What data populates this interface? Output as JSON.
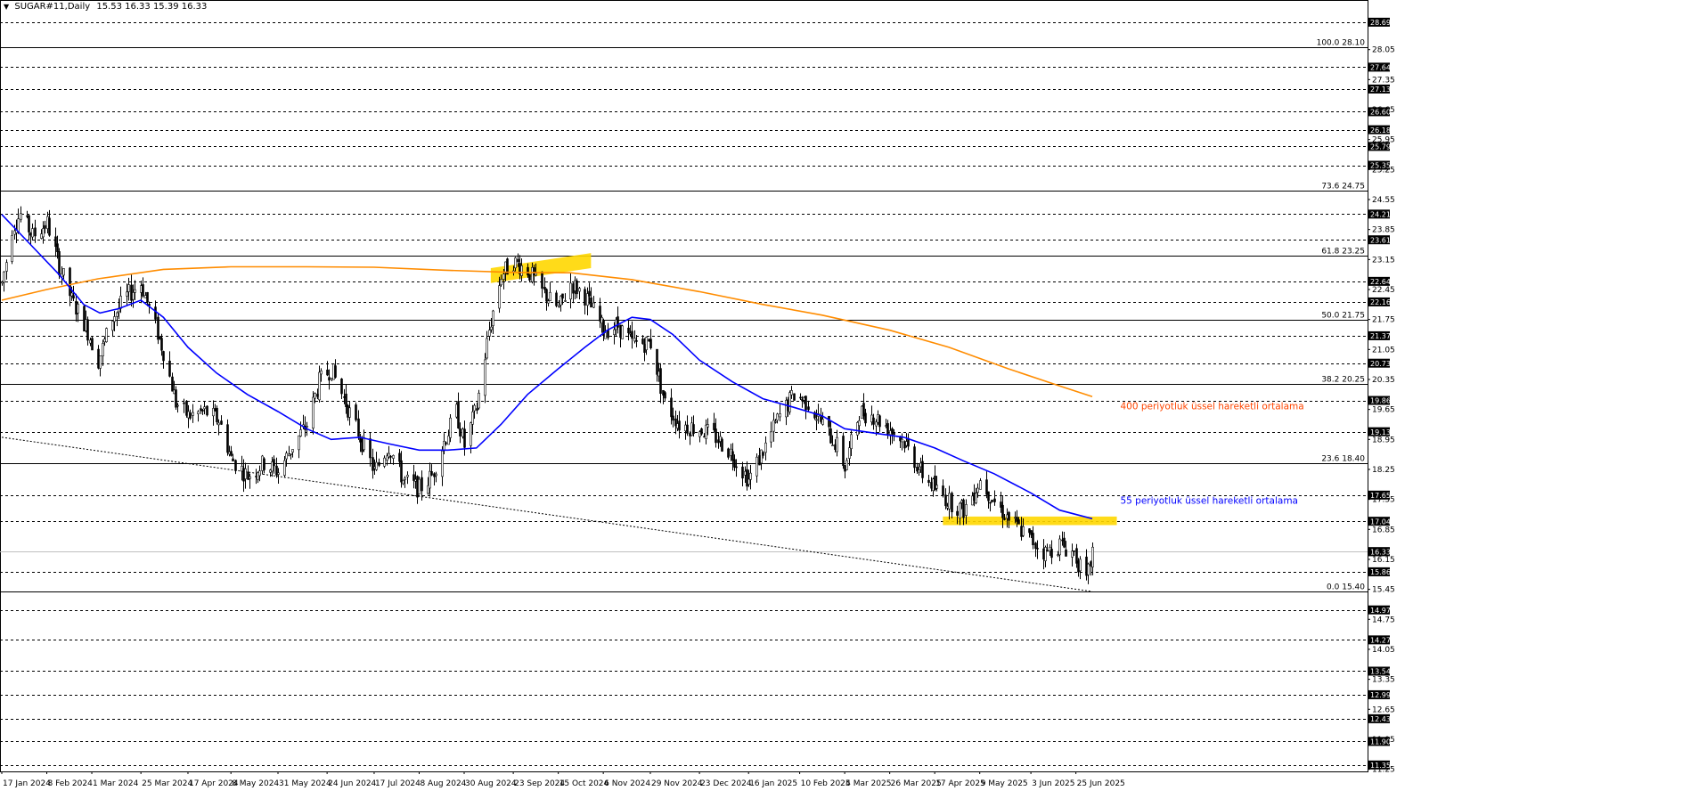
{
  "main": {
    "symbol_bar": {
      "symbol": "SUGAR#11,Daily",
      "ohlc": "15.53 16.33 15.39 16.33"
    },
    "colors": {
      "background": "#ffffff",
      "grid_dashed": "#000000",
      "candle": "#000000",
      "ema55": "#0000ff",
      "ema400": "#ff8c00",
      "highlight": "#ffd700",
      "label_blue": "#0000ff",
      "label_orange": "#ff4500",
      "axis_badge_bg": "#000000",
      "axis_badge_text": "#ffffff",
      "current_price_line": "#c0c0c0"
    },
    "annotations": [
      {
        "text": "400 periyotluk üssel hareketli ortalama",
        "color": "#ff4500",
        "anchor_date": "2025-07-08",
        "price": 19.65
      },
      {
        "text": "55 periyotluk üssel hareketli ortalama",
        "color": "#0000ff",
        "anchor_date": "2025-07-08",
        "price": 17.45
      }
    ]
  },
  "chart_data": {
    "type": "candlestick",
    "title": "SUGAR#11,Daily",
    "ylim": [
      11.2,
      29.0
    ],
    "x_start": "2024-01-17",
    "x_end": "2025-07-03",
    "current_price": 16.33,
    "axis_badges": [
      28.69,
      27.64,
      27.13,
      26.6,
      26.18,
      25.79,
      25.35,
      24.21,
      23.61,
      22.64,
      22.16,
      21.37,
      20.73,
      19.86,
      19.13,
      17.65,
      17.04,
      16.33,
      15.86,
      14.97,
      14.27,
      13.54,
      12.99,
      12.43,
      11.9,
      11.35
    ],
    "axis_small_ticks": [
      28.05,
      27.35,
      26.65,
      25.95,
      25.25,
      24.55,
      23.85,
      23.15,
      22.45,
      21.75,
      21.05,
      20.35,
      19.65,
      18.95,
      18.25,
      17.55,
      16.85,
      16.15,
      15.45,
      14.75,
      14.05,
      13.35,
      12.65,
      11.95,
      11.25
    ],
    "dashed_levels": [
      28.69,
      27.64,
      27.13,
      26.6,
      26.18,
      25.79,
      25.35,
      24.21,
      23.61,
      22.64,
      22.16,
      21.37,
      20.73,
      19.86,
      19.13,
      17.65,
      17.04,
      15.86,
      14.97,
      14.27,
      13.54,
      12.99,
      12.43,
      11.9,
      11.35
    ],
    "fib_levels": [
      {
        "label": "100.0 28.10",
        "value": 28.1
      },
      {
        "label": "73.6 24.75",
        "value": 24.75
      },
      {
        "label": "61.8 23.25",
        "value": 23.25
      },
      {
        "label": "50.0 21.75",
        "value": 21.75
      },
      {
        "label": "38.2 20.25",
        "value": 20.25
      },
      {
        "label": "23.6 18.40",
        "value": 18.4
      },
      {
        "label": "0.0 15.40",
        "value": 15.4
      }
    ],
    "date_labels": [
      {
        "label": "17 Jan 2024",
        "date": "2024-01-17"
      },
      {
        "label": "8 Feb 2024",
        "date": "2024-02-08"
      },
      {
        "label": "1 Mar 2024",
        "date": "2024-03-01"
      },
      {
        "label": "25 Mar 2024",
        "date": "2024-03-25"
      },
      {
        "label": "17 Apr 2024",
        "date": "2024-04-17"
      },
      {
        "label": "8 May 2024",
        "date": "2024-05-08"
      },
      {
        "label": "31 May 2024",
        "date": "2024-05-31"
      },
      {
        "label": "24 Jun 2024",
        "date": "2024-06-24"
      },
      {
        "label": "17 Jul 2024",
        "date": "2024-07-17"
      },
      {
        "label": "8 Aug 2024",
        "date": "2024-08-08"
      },
      {
        "label": "30 Aug 2024",
        "date": "2024-08-30"
      },
      {
        "label": "23 Sep 2024",
        "date": "2024-09-23"
      },
      {
        "label": "15 Oct 2024",
        "date": "2024-10-15"
      },
      {
        "label": "6 Nov 2024",
        "date": "2024-11-06"
      },
      {
        "label": "29 Nov 2024",
        "date": "2024-11-29"
      },
      {
        "label": "23 Dec 2024",
        "date": "2024-12-23"
      },
      {
        "label": "16 Jan 2025",
        "date": "2025-01-16"
      },
      {
        "label": "10 Feb 2025",
        "date": "2025-02-10"
      },
      {
        "label": "4 Mar 2025",
        "date": "2025-03-04"
      },
      {
        "label": "26 Mar 2025",
        "date": "2025-03-26"
      },
      {
        "label": "17 Apr 2025",
        "date": "2025-04-17"
      },
      {
        "label": "9 May 2025",
        "date": "2025-05-09"
      },
      {
        "label": "3 Jun 2025",
        "date": "2025-06-03"
      },
      {
        "label": "25 Jun 2025",
        "date": "2025-06-25"
      }
    ],
    "price_path": [
      [
        "2024-01-17",
        22.6
      ],
      [
        "2024-01-22",
        23.9
      ],
      [
        "2024-01-26",
        24.2
      ],
      [
        "2024-02-01",
        23.7
      ],
      [
        "2024-02-08",
        24.0
      ],
      [
        "2024-02-14",
        23.0
      ],
      [
        "2024-02-20",
        22.2
      ],
      [
        "2024-02-27",
        21.6
      ],
      [
        "2024-03-04",
        20.8
      ],
      [
        "2024-03-11",
        21.8
      ],
      [
        "2024-03-18",
        22.3
      ],
      [
        "2024-03-25",
        22.6
      ],
      [
        "2024-03-29",
        22.0
      ],
      [
        "2024-04-05",
        21.0
      ],
      [
        "2024-04-11",
        19.8
      ],
      [
        "2024-04-17",
        19.5
      ],
      [
        "2024-04-25",
        19.6
      ],
      [
        "2024-05-02",
        19.4
      ],
      [
        "2024-05-08",
        18.5
      ],
      [
        "2024-05-16",
        18.1
      ],
      [
        "2024-05-24",
        18.4
      ],
      [
        "2024-05-31",
        18.2
      ],
      [
        "2024-06-07",
        18.8
      ],
      [
        "2024-06-14",
        19.3
      ],
      [
        "2024-06-20",
        20.3
      ],
      [
        "2024-06-26",
        20.6
      ],
      [
        "2024-07-03",
        19.8
      ],
      [
        "2024-07-10",
        19.0
      ],
      [
        "2024-07-17",
        18.2
      ],
      [
        "2024-07-24",
        18.8
      ],
      [
        "2024-07-31",
        18.0
      ],
      [
        "2024-08-08",
        17.8
      ],
      [
        "2024-08-14",
        18.1
      ],
      [
        "2024-08-20",
        18.9
      ],
      [
        "2024-08-26",
        19.6
      ],
      [
        "2024-08-30",
        18.8
      ],
      [
        "2024-09-05",
        19.7
      ],
      [
        "2024-09-11",
        21.5
      ],
      [
        "2024-09-17",
        22.8
      ],
      [
        "2024-09-23",
        23.1
      ],
      [
        "2024-09-30",
        22.9
      ],
      [
        "2024-10-07",
        22.4
      ],
      [
        "2024-10-15",
        22.0
      ],
      [
        "2024-10-21",
        22.6
      ],
      [
        "2024-10-28",
        22.3
      ],
      [
        "2024-11-06",
        21.5
      ],
      [
        "2024-11-13",
        21.6
      ],
      [
        "2024-11-20",
        21.2
      ],
      [
        "2024-11-29",
        21.2
      ],
      [
        "2024-12-06",
        19.8
      ],
      [
        "2024-12-13",
        19.3
      ],
      [
        "2024-12-23",
        19.2
      ],
      [
        "2024-12-31",
        19.0
      ],
      [
        "2025-01-08",
        18.6
      ],
      [
        "2025-01-16",
        18.0
      ],
      [
        "2025-01-23",
        18.7
      ],
      [
        "2025-01-31",
        19.5
      ],
      [
        "2025-02-07",
        20.0
      ],
      [
        "2025-02-14",
        19.8
      ],
      [
        "2025-02-21",
        19.3
      ],
      [
        "2025-02-28",
        18.8
      ],
      [
        "2025-03-04",
        18.3
      ],
      [
        "2025-03-11",
        19.6
      ],
      [
        "2025-03-18",
        19.5
      ],
      [
        "2025-03-26",
        19.2
      ],
      [
        "2025-04-02",
        18.9
      ],
      [
        "2025-04-10",
        18.2
      ],
      [
        "2025-04-17",
        17.8
      ],
      [
        "2025-04-24",
        17.5
      ],
      [
        "2025-05-01",
        17.3
      ],
      [
        "2025-05-09",
        18.0
      ],
      [
        "2025-05-16",
        17.5
      ],
      [
        "2025-05-23",
        17.1
      ],
      [
        "2025-06-03",
        16.6
      ],
      [
        "2025-06-10",
        16.3
      ],
      [
        "2025-06-17",
        16.5
      ],
      [
        "2025-06-24",
        16.3
      ],
      [
        "2025-06-30",
        15.6
      ],
      [
        "2025-07-03",
        16.33
      ]
    ],
    "ema55": [
      [
        "2024-01-17",
        24.2
      ],
      [
        "2024-01-31",
        23.5
      ],
      [
        "2024-02-14",
        22.8
      ],
      [
        "2024-02-26",
        22.1
      ],
      [
        "2024-03-05",
        21.9
      ],
      [
        "2024-03-14",
        22.0
      ],
      [
        "2024-03-25",
        22.2
      ],
      [
        "2024-04-05",
        21.8
      ],
      [
        "2024-04-17",
        21.1
      ],
      [
        "2024-05-01",
        20.5
      ],
      [
        "2024-05-16",
        20.0
      ],
      [
        "2024-05-31",
        19.6
      ],
      [
        "2024-06-14",
        19.2
      ],
      [
        "2024-06-26",
        18.95
      ],
      [
        "2024-07-10",
        19.0
      ],
      [
        "2024-07-24",
        18.85
      ],
      [
        "2024-08-08",
        18.7
      ],
      [
        "2024-08-22",
        18.7
      ],
      [
        "2024-09-05",
        18.75
      ],
      [
        "2024-09-17",
        19.3
      ],
      [
        "2024-09-30",
        20.0
      ],
      [
        "2024-10-15",
        20.6
      ],
      [
        "2024-10-28",
        21.1
      ],
      [
        "2024-11-08",
        21.5
      ],
      [
        "2024-11-20",
        21.8
      ],
      [
        "2024-11-29",
        21.75
      ],
      [
        "2024-12-10",
        21.4
      ],
      [
        "2024-12-23",
        20.8
      ],
      [
        "2025-01-08",
        20.3
      ],
      [
        "2025-01-23",
        19.9
      ],
      [
        "2025-02-07",
        19.7
      ],
      [
        "2025-02-21",
        19.5
      ],
      [
        "2025-03-04",
        19.2
      ],
      [
        "2025-03-18",
        19.1
      ],
      [
        "2025-04-02",
        19.0
      ],
      [
        "2025-04-17",
        18.75
      ],
      [
        "2025-05-01",
        18.45
      ],
      [
        "2025-05-16",
        18.15
      ],
      [
        "2025-06-03",
        17.7
      ],
      [
        "2025-06-17",
        17.3
      ],
      [
        "2025-07-03",
        17.1
      ]
    ],
    "ema400": [
      [
        "2024-01-17",
        22.2
      ],
      [
        "2024-02-08",
        22.45
      ],
      [
        "2024-03-04",
        22.7
      ],
      [
        "2024-04-05",
        22.92
      ],
      [
        "2024-05-08",
        22.98
      ],
      [
        "2024-06-14",
        22.98
      ],
      [
        "2024-07-17",
        22.97
      ],
      [
        "2024-08-20",
        22.9
      ],
      [
        "2024-09-23",
        22.85
      ],
      [
        "2024-10-21",
        22.84
      ],
      [
        "2024-11-20",
        22.68
      ],
      [
        "2024-12-23",
        22.4
      ],
      [
        "2025-01-23",
        22.1
      ],
      [
        "2025-02-21",
        21.85
      ],
      [
        "2025-03-26",
        21.5
      ],
      [
        "2025-04-24",
        21.1
      ],
      [
        "2025-05-23",
        20.6
      ],
      [
        "2025-06-17",
        20.2
      ],
      [
        "2025-07-03",
        19.95
      ]
    ],
    "trendline": [
      [
        "2024-01-17",
        19.0
      ],
      [
        "2025-07-03",
        15.4
      ]
    ],
    "highlights": [
      {
        "from": "2024-09-12",
        "to": "2024-10-31",
        "low": 22.6,
        "high": 22.95,
        "tilt": 0.35
      },
      {
        "from": "2025-04-21",
        "to": "2025-07-15",
        "low": 16.95,
        "high": 17.15,
        "tilt": 0
      }
    ]
  }
}
